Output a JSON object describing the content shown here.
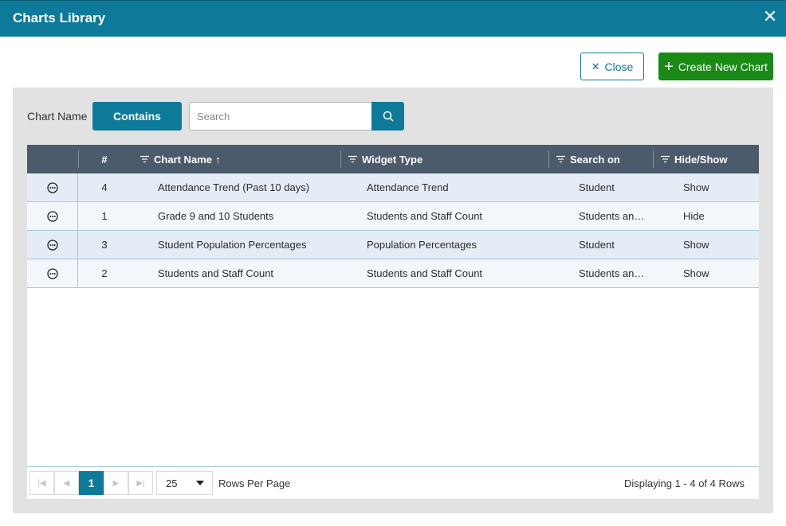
{
  "dialog": {
    "title": "Charts Library",
    "close_icon": "close-icon"
  },
  "toolbar": {
    "close_label": "Close",
    "create_label": "Create New Chart"
  },
  "filter": {
    "label": "Chart Name",
    "operator": "Contains",
    "search_placeholder": "Search",
    "search_value": ""
  },
  "grid": {
    "columns": [
      "#",
      "Chart Name",
      "Widget Type",
      "Search on",
      "Hide/Show"
    ],
    "sort_indicator": "↑",
    "rows": [
      {
        "num": "4",
        "name": "Attendance Trend (Past 10 days)",
        "type": "Attendance Trend",
        "search_on": "Student",
        "visibility": "Show"
      },
      {
        "num": "1",
        "name": "Grade 9 and 10 Students",
        "type": "Students and Staff Count",
        "search_on": "Students an…",
        "visibility": "Hide"
      },
      {
        "num": "3",
        "name": "Student Population Percentages",
        "type": "Population Percentages",
        "search_on": "Student",
        "visibility": "Show"
      },
      {
        "num": "2",
        "name": "Students and Staff Count",
        "type": "Students and Staff Count",
        "search_on": "Students an…",
        "visibility": "Show"
      }
    ]
  },
  "pager": {
    "current_page": "1",
    "rows_per_page": "25",
    "rows_per_page_label": "Rows Per Page",
    "display_text": "Displaying 1 - 4 of 4 Rows"
  },
  "colors": {
    "accent": "#0e7a9a",
    "create_button": "#1a8a16",
    "grid_header": "#4b5b6b"
  }
}
